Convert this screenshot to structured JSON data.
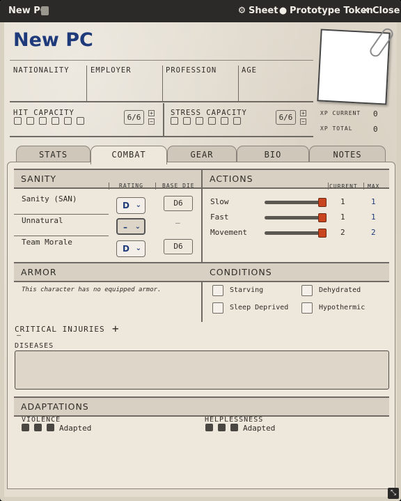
{
  "window": {
    "title": "New PC",
    "sheet_label": "Sheet",
    "token_label": "Prototype Token",
    "close_label": "Close"
  },
  "header": {
    "name": "New PC",
    "nationality": "NATIONALITY",
    "employer": "EMPLOYER",
    "profession": "PROFESSION",
    "age": "AGE",
    "hit_capacity": "HIT CAPACITY",
    "hit_value": "6/6",
    "stress_capacity": "STRESS CAPACITY",
    "stress_value": "6/6",
    "xp_current_label": "XP CURRENT",
    "xp_current": "0",
    "xp_total_label": "XP TOTAL",
    "xp_total": "0"
  },
  "tabs": [
    {
      "label": "STATS"
    },
    {
      "label": "COMBAT"
    },
    {
      "label": "GEAR"
    },
    {
      "label": "BIO"
    },
    {
      "label": "NOTES"
    }
  ],
  "sanity": {
    "title": "SANITY",
    "rating_header": "RATING",
    "base_header": "BASE DIE",
    "rows": [
      {
        "label": "Sanity (SAN)",
        "rating": "D",
        "base": "D6"
      },
      {
        "label": "Unnatural",
        "rating": "–",
        "base": "–"
      },
      {
        "label": "Team Morale",
        "rating": "D",
        "base": "D6"
      }
    ]
  },
  "actions": {
    "title": "ACTIONS",
    "current_header": "CURRENT",
    "max_header": "MAX",
    "rows": [
      {
        "label": "Slow",
        "current": "1",
        "max": "1",
        "level": 1.0
      },
      {
        "label": "Fast",
        "current": "1",
        "max": "1",
        "level": 1.0
      },
      {
        "label": "Movement",
        "current": "2",
        "max": "2",
        "level": 1.0
      }
    ]
  },
  "armor": {
    "title": "ARMOR",
    "empty_text": "This character has no equipped armor."
  },
  "conditions": {
    "title": "CONDITIONS",
    "items": [
      "Starving",
      "Dehydrated",
      "Sleep Deprived",
      "Hypothermic"
    ]
  },
  "injuries": {
    "label": "CRITICAL INJURIES",
    "add": "+",
    "dash": "–"
  },
  "diseases": {
    "label": "DISEASES"
  },
  "adaptations": {
    "title": "ADAPTATIONS",
    "violence": "VIOLENCE",
    "helplessness": "HELPLESSNESS",
    "adapted": "Adapted"
  }
}
